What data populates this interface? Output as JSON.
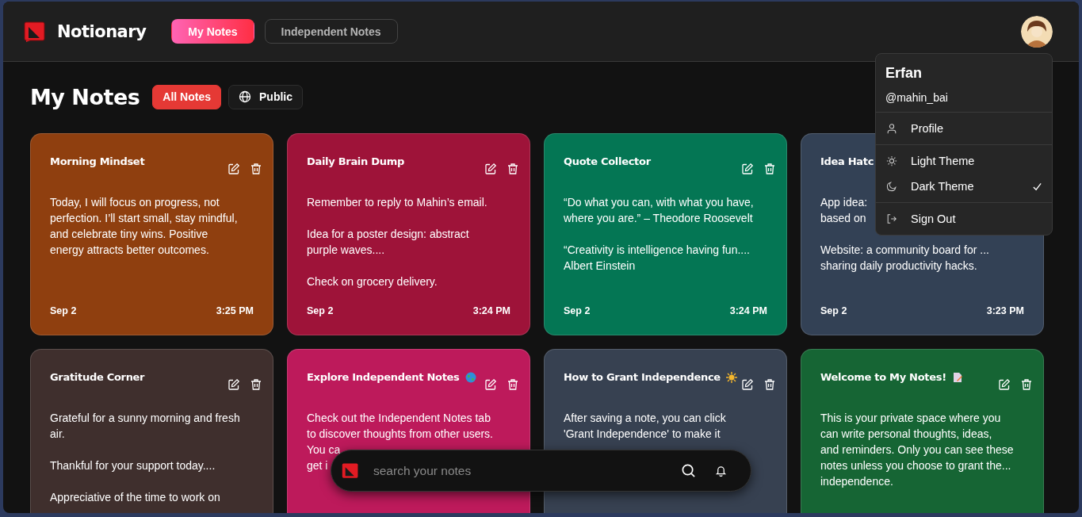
{
  "app": {
    "name": "Notionary"
  },
  "nav_tabs": [
    {
      "label": "My Notes",
      "selected": true
    },
    {
      "label": "Independent Notes",
      "selected": false
    }
  ],
  "heading": "My Notes",
  "filters": [
    {
      "label": "All Notes",
      "selected": true,
      "kind": "plain"
    },
    {
      "label": "Public",
      "selected": false,
      "kind": "globe"
    }
  ],
  "notes": [
    {
      "title": "Morning Mindset",
      "kind": "plain",
      "actions": [
        {
          "kind": "edit"
        },
        {
          "kind": "delete"
        }
      ],
      "color": "#8f3f0f",
      "body": [
        "Today, I will focus on progress, not\nperfection. I’ll start small, stay mindful,\nand celebrate tiny wins. Positive\nenergy attracts better outcomes."
      ],
      "date": "Sep 2",
      "time": "3:25 PM"
    },
    {
      "title": "Daily Brain Dump",
      "kind": "plain",
      "actions": [
        {
          "kind": "edit"
        },
        {
          "kind": "delete"
        }
      ],
      "color": "#9e1339",
      "body": [
        "Remember to reply to Mahin’s email.\n\nIdea for a poster design: abstract\npurple waves....\n\nCheck on grocery delivery."
      ],
      "date": "Sep 2",
      "time": "3:24 PM"
    },
    {
      "title": "Quote Collector",
      "kind": "plain",
      "actions": [
        {
          "kind": "edit"
        },
        {
          "kind": "delete"
        }
      ],
      "color": "#047654",
      "body": [
        "“Do what you can, with what you have,\nwhere you are.” – Theodore Roosevelt\n\n“Creativity is intelligence having fun....\nAlbert Einstein"
      ],
      "date": "Sep 2",
      "time": "3:24 PM"
    },
    {
      "title": "Idea Hatc",
      "kind": "plain",
      "color": "#334155",
      "body": [
        "App idea:\nbased on",
        "\nWebsite: a community board for ...\nsharing daily productivity hacks."
      ],
      "date": "Sep 2",
      "time": "3:23 PM"
    },
    {
      "title": "Gratitude Corner",
      "kind": "plain",
      "actions": [
        {
          "kind": "edit"
        },
        {
          "kind": "delete"
        }
      ],
      "color": "#3f2f2d",
      "body": [
        "Grateful for a sunny morning and fresh\nair.\n\nThankful for your support today....\n\nAppreciative of the time to work on"
      ]
    },
    {
      "title": "Explore Independent Notes",
      "kind": "globe",
      "actions": [
        {
          "kind": "edit"
        },
        {
          "kind": "delete"
        }
      ],
      "color": "#bd1a5b",
      "body": [
        "Check out the Independent Notes tab\nto discover thoughts from other users.",
        "You ca\nget i"
      ]
    },
    {
      "title": "How to Grant Independence",
      "kind": "sun",
      "actions": [
        {
          "kind": "edit"
        },
        {
          "kind": "delete"
        }
      ],
      "color": "#374151",
      "body": [
        "After saving a note, you can click\n'Grant Independence' to make it"
      ]
    },
    {
      "title": "Welcome to My Notes!",
      "kind": "memo",
      "actions": [
        {
          "kind": "edit"
        },
        {
          "kind": "delete"
        }
      ],
      "color": "#166534",
      "body": [
        "This is your private space where you\ncan write personal thoughts, ideas,\nand reminders. Only you can see these\nnotes unless you choose to grant the...\nindependence."
      ]
    }
  ],
  "user_menu": {
    "name": "Erfan",
    "handle": "@mahin_bai",
    "profile": "Profile",
    "themes": [
      {
        "label": "Light Theme",
        "selected": false
      },
      {
        "label": "Dark Theme",
        "selected": true
      }
    ],
    "sign_out": "Sign Out"
  },
  "search": {
    "placeholder": "search your notes"
  }
}
